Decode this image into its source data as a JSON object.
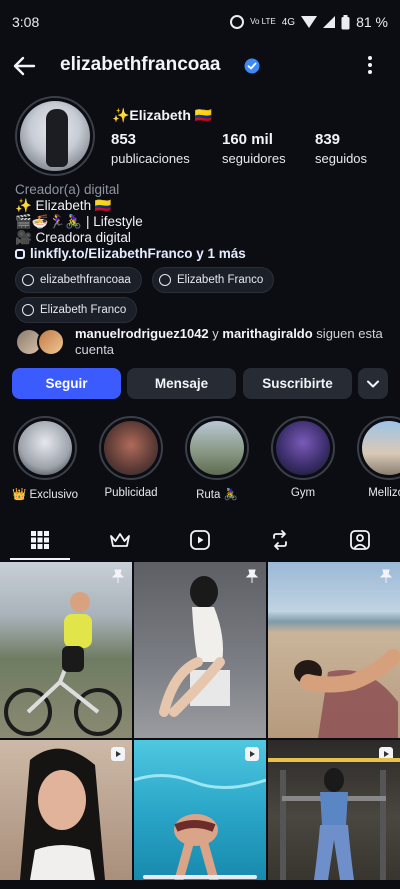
{
  "status_bar": {
    "time": "3:08",
    "network_label": "Vo LTE",
    "network_type": "4G",
    "battery_percent": "81 %",
    "icons": [
      "alarm-icon",
      "volte-icon",
      "wifi-icon",
      "cell-signal-icon",
      "battery-icon"
    ]
  },
  "header": {
    "username": "elizabethfrancoaa",
    "icons": [
      "back-arrow-icon",
      "verified-badge-icon",
      "more-vertical-icon"
    ]
  },
  "profile": {
    "display_name": "✨Elizabeth 🇨🇴",
    "stats": [
      {
        "number": "853",
        "label": "publicaciones"
      },
      {
        "number": "160 mil",
        "label": "seguidores"
      },
      {
        "number": "839",
        "label": "seguidos"
      }
    ]
  },
  "bio": {
    "category": "Creador(a) digital",
    "lines": [
      "✨ Elizabeth 🇨🇴",
      "🎬🍜🏃‍♀️🚴‍♀️ | Lifestyle",
      "🎥 Creadora digital"
    ],
    "link": "linkfly.to/ElizabethFranco y 1 más"
  },
  "chips": [
    {
      "label": "elizabethfrancoaa",
      "icon": "threads-icon"
    },
    {
      "label": "Elizabeth Franco",
      "icon": "facebook-icon"
    },
    {
      "label": "Elizabeth Franco",
      "icon": "facebook-icon"
    }
  ],
  "followed_by": {
    "user1": "manuelrodriguez1042",
    "connector": " y ",
    "user2": "marithagiraldo",
    "suffix": " siguen esta cuenta"
  },
  "actions": {
    "follow": "Seguir",
    "message": "Mensaje",
    "subscribe": "Suscribirte"
  },
  "highlights": [
    {
      "label": "👑 Exclusivo"
    },
    {
      "label": "Publicidad"
    },
    {
      "label": "Ruta 🚴‍♀️"
    },
    {
      "label": "Gym"
    },
    {
      "label": "Mellizos"
    }
  ],
  "tabs": [
    "grid-icon",
    "crown-icon",
    "reels-icon",
    "reposts-icon",
    "tagged-icon"
  ],
  "colors": {
    "background": "#0b0d12",
    "primary_button": "#3b5bff",
    "secondary_button": "#262b34",
    "verified_blue": "#3d8af7"
  }
}
